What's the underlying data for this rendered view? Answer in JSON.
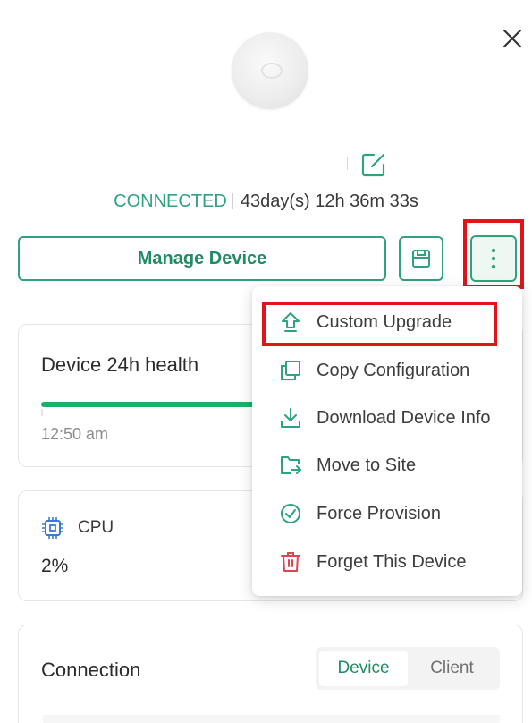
{
  "header": {
    "close_icon": "close-icon",
    "device_image": "device-image"
  },
  "status": {
    "state": "CONNECTED",
    "uptime": "43day(s) 12h 36m 33s"
  },
  "actions": {
    "manage_label": "Manage Device",
    "save_icon": "save-icon",
    "more_icon": "more-vertical-icon"
  },
  "health": {
    "title": "Device 24h health",
    "time_label": "12:50 am"
  },
  "cpu": {
    "label": "CPU",
    "value": "2%"
  },
  "connection": {
    "title": "Connection",
    "tabs": [
      {
        "label": "Device"
      },
      {
        "label": "Client"
      }
    ]
  },
  "menu": {
    "items": [
      {
        "label": "Custom Upgrade",
        "icon": "upload-icon"
      },
      {
        "label": "Copy Configuration",
        "icon": "copy-icon"
      },
      {
        "label": "Download Device Info",
        "icon": "download-icon"
      },
      {
        "label": "Move to Site",
        "icon": "move-folder-icon"
      },
      {
        "label": "Force Provision",
        "icon": "check-circle-icon"
      },
      {
        "label": "Forget This Device",
        "icon": "trash-icon"
      }
    ]
  },
  "colors": {
    "accent": "#2fa37a",
    "highlight": "#e0141b",
    "danger": "#e0454f"
  }
}
